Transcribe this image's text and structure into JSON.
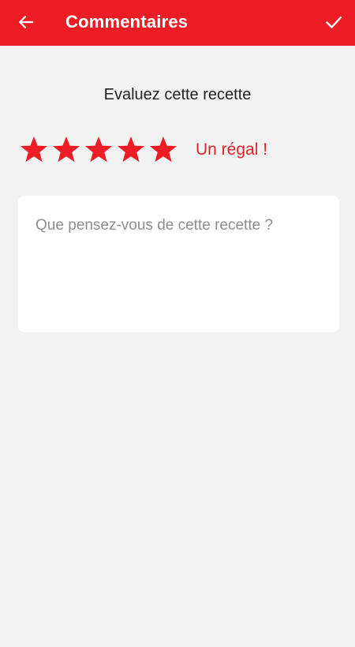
{
  "app_bar": {
    "title": "Commentaires",
    "back_icon": "arrow-left-icon",
    "confirm_icon": "check-icon",
    "color": "#ee1d25"
  },
  "heading": "Evaluez cette recette",
  "rating": {
    "value": 5,
    "max": 5,
    "label": "Un régal !",
    "star_color": "#ee1d25"
  },
  "comment": {
    "value": "",
    "placeholder": "Que pensez-vous de cette recette ?"
  }
}
